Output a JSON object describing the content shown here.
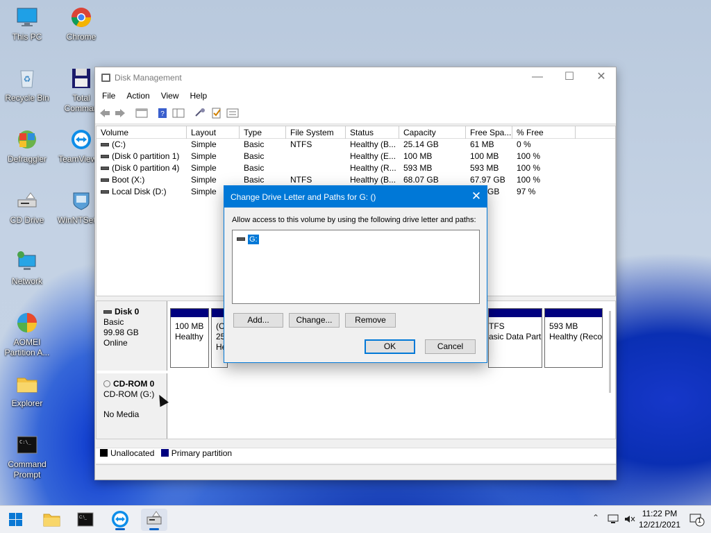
{
  "desktop": {
    "icons": [
      {
        "label": "This PC",
        "icon": "computer-icon"
      },
      {
        "label": "Chrome",
        "icon": "chrome-icon"
      },
      {
        "label": "Recycle Bin",
        "icon": "recycle-bin-icon"
      },
      {
        "label": "Total Comman",
        "icon": "floppy-icon"
      },
      {
        "label": "Defraggler",
        "icon": "defraggler-icon"
      },
      {
        "label": "TeamViewer",
        "icon": "teamviewer-icon"
      },
      {
        "label": "CD Drive",
        "icon": "cd-drive-icon"
      },
      {
        "label": "WinNTSetup",
        "icon": "winntsetup-icon"
      },
      {
        "label": "Network",
        "icon": "network-icon"
      },
      {
        "label": "AOMEI Partition A...",
        "icon": "aomei-icon"
      },
      {
        "label": "Explorer",
        "icon": "folder-icon"
      },
      {
        "label": "Command Prompt",
        "icon": "cmd-icon"
      }
    ]
  },
  "window": {
    "title": "Disk Management",
    "menu": [
      "File",
      "Action",
      "View",
      "Help"
    ],
    "columns": [
      "Volume",
      "Layout",
      "Type",
      "File System",
      "Status",
      "Capacity",
      "Free Spa...",
      "% Free"
    ],
    "volumes": [
      {
        "volume": "(C:)",
        "layout": "Simple",
        "type": "Basic",
        "fs": "NTFS",
        "status": "Healthy (B...",
        "capacity": "25.14 GB",
        "free": "61 MB",
        "pct": "0 %"
      },
      {
        "volume": "(Disk 0 partition 1)",
        "layout": "Simple",
        "type": "Basic",
        "fs": "",
        "status": "Healthy (E...",
        "capacity": "100 MB",
        "free": "100 MB",
        "pct": "100 %"
      },
      {
        "volume": "(Disk 0 partition 4)",
        "layout": "Simple",
        "type": "Basic",
        "fs": "",
        "status": "Healthy (R...",
        "capacity": "593 MB",
        "free": "593 MB",
        "pct": "100 %"
      },
      {
        "volume": "Boot (X:)",
        "layout": "Simple",
        "type": "Basic",
        "fs": "NTFS",
        "status": "Healthy (B...",
        "capacity": "68.07 GB",
        "free": "67.97 GB",
        "pct": "100 %"
      },
      {
        "volume": "Local Disk (D:)",
        "layout": "Simple",
        "type": "",
        "fs": "",
        "status": "",
        "capacity": "",
        "free": "GB",
        "pct": "97 %"
      }
    ],
    "disk0": {
      "name": "Disk 0",
      "type": "Basic",
      "size": "99.98 GB",
      "state": "Online"
    },
    "disk0_parts": [
      {
        "line1": "100 MB",
        "line2": "Healthy"
      },
      {
        "line1": "(C",
        "line2": "25"
      },
      {
        "line1": "He",
        "line2": ""
      },
      {
        "line1": "TFS",
        "line2": "asic Data Part"
      },
      {
        "line1": "593 MB",
        "line2": "Healthy (Reco"
      }
    ],
    "cdrom": {
      "name": "CD-ROM 0",
      "type": "CD-ROM (G:)",
      "state": "No Media"
    },
    "legend": [
      {
        "label": "Unallocated",
        "color": "#000000"
      },
      {
        "label": "Primary partition",
        "color": "#00007f"
      }
    ]
  },
  "dialog": {
    "title": "Change Drive Letter and Paths for G: ()",
    "description": "Allow access to this volume by using the following drive letter and paths:",
    "items": [
      "G:"
    ],
    "buttons": {
      "add": "Add...",
      "change": "Change...",
      "remove": "Remove",
      "ok": "OK",
      "cancel": "Cancel"
    }
  },
  "taskbar": {
    "time": "11:22 PM",
    "date": "12/21/2021",
    "notification_count": "1"
  }
}
